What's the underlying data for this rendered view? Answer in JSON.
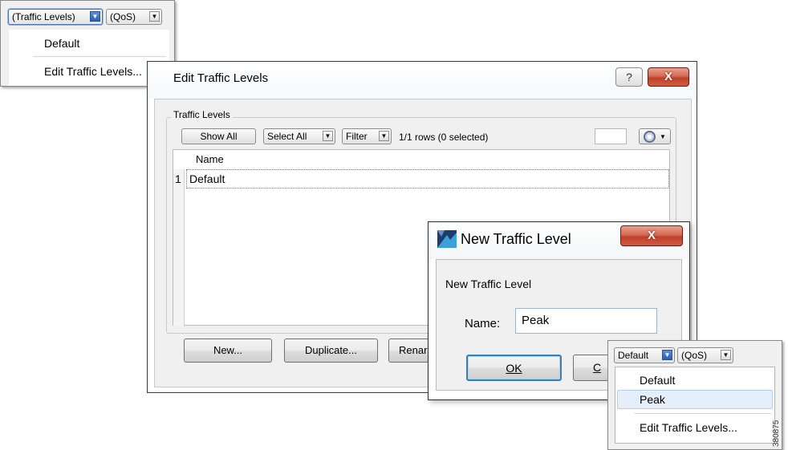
{
  "top_dropdown": {
    "traffic_combo": "(Traffic Levels)",
    "qos_combo": "(QoS)",
    "menu_items": [
      "Default",
      "Edit Traffic Levels..."
    ]
  },
  "edit_dialog": {
    "title": "Edit Traffic Levels",
    "help_button": "?",
    "close_button": "X",
    "group_label": "Traffic Levels",
    "toolbar": {
      "show_all": "Show All",
      "select_all": "Select All",
      "filter": "Filter",
      "rows_info": "1/1 rows (0 selected)"
    },
    "table": {
      "column_header": "Name",
      "rows": [
        {
          "index": "1",
          "name": "Default"
        }
      ]
    },
    "buttons": {
      "new": "New...",
      "duplicate": "Duplicate...",
      "rename": "Renar"
    }
  },
  "new_dialog": {
    "title": "New Traffic Level",
    "close_button": "X",
    "heading": "New Traffic Level",
    "name_label": "Name:",
    "name_value": "Peak",
    "ok_button": "OK",
    "cancel_button": "C"
  },
  "bottom_dropdown": {
    "traffic_combo": "Default",
    "qos_combo": "(QoS)",
    "menu_items": [
      "Default",
      "Peak",
      "Edit Traffic Levels..."
    ],
    "hovered_item": "Peak"
  },
  "figure_id": "380875",
  "icons": [
    "dropdown-arrow-icon",
    "help-icon",
    "close-icon",
    "gear-icon",
    "app-logo-icon"
  ]
}
